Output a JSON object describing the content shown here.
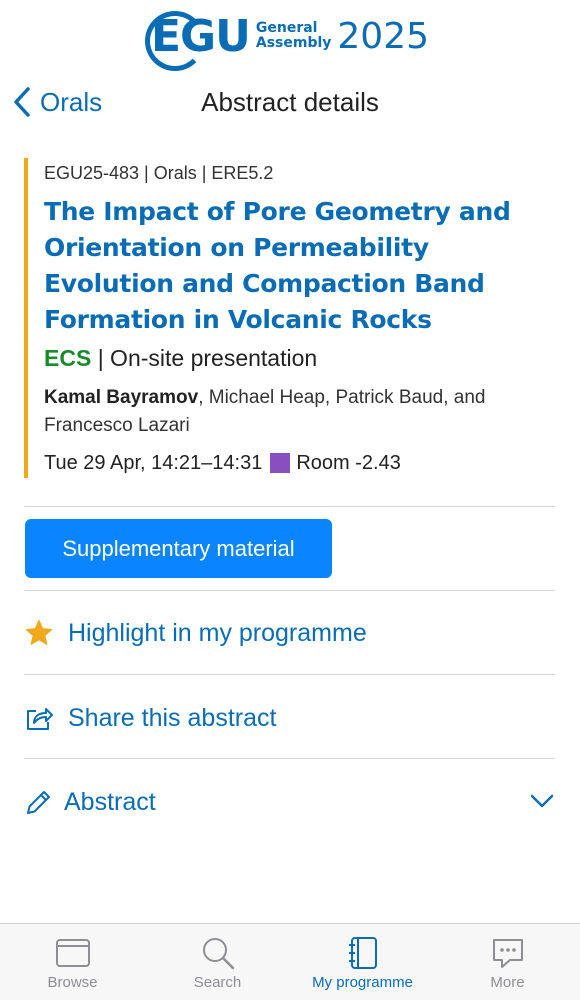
{
  "header": {
    "logo_egu": "EGU",
    "logo_line1": "General",
    "logo_line2": "Assembly",
    "logo_year": "2025",
    "back_label": "Orals",
    "title": "Abstract details"
  },
  "abstract": {
    "meta": "EGU25-483 | Orals | ERE5.2",
    "title": "The Impact of Pore Geometry and Orientation on Permeability Evolution and Compaction Band Formation in Volcanic Rocks",
    "ecs": "ECS",
    "presentation": "| On-site presentation",
    "lead_author": "Kamal Bayramov",
    "other_authors": ", Michael Heap, Patrick Baud, and Francesco Lazari",
    "time": "Tue 29 Apr, 14:21–14:31",
    "room": "Room -2.43",
    "room_color": "#8a4fbf",
    "accent_bar_color": "#f0a81c"
  },
  "actions": {
    "supplementary_label": "Supplementary material",
    "highlight_label": "Highlight in my programme",
    "share_label": "Share this abstract",
    "abstract_label": "Abstract"
  },
  "tabbar": {
    "items": [
      {
        "label": "Browse",
        "icon": "browser-window-icon"
      },
      {
        "label": "Search",
        "icon": "search-icon"
      },
      {
        "label": "My programme",
        "icon": "notebook-icon",
        "active": true
      },
      {
        "label": "More",
        "icon": "chat-bubble-icon"
      }
    ]
  }
}
